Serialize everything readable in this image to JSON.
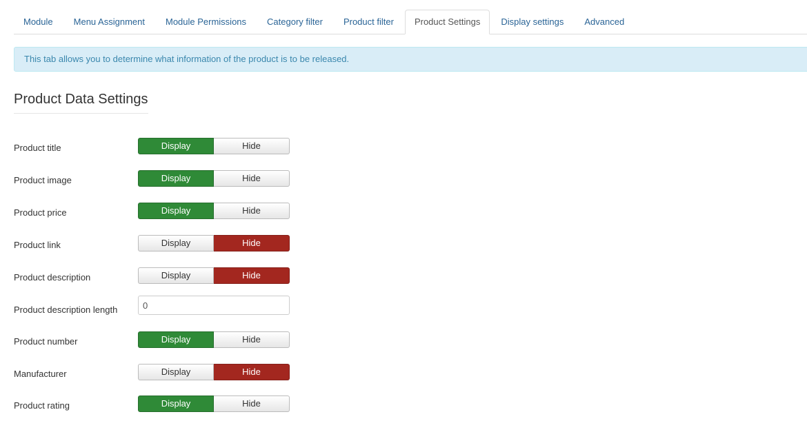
{
  "tabs": [
    {
      "label": "Module",
      "active": false
    },
    {
      "label": "Menu Assignment",
      "active": false
    },
    {
      "label": "Module Permissions",
      "active": false
    },
    {
      "label": "Category filter",
      "active": false
    },
    {
      "label": "Product filter",
      "active": false
    },
    {
      "label": "Product Settings",
      "active": true
    },
    {
      "label": "Display settings",
      "active": false
    },
    {
      "label": "Advanced",
      "active": false
    }
  ],
  "alert": {
    "text": "This tab allows you to determine what information of the product is to be released."
  },
  "section": {
    "title": "Product Data Settings"
  },
  "toggle_labels": {
    "display": "Display",
    "hide": "Hide"
  },
  "colors": {
    "display_active": "#2f8a37",
    "hide_active": "#a3271f",
    "link": "#2a6496",
    "alert_bg": "#d9edf7"
  },
  "settings": {
    "product_title": {
      "label": "Product title",
      "state": "display"
    },
    "product_image": {
      "label": "Product image",
      "state": "display"
    },
    "product_price": {
      "label": "Product price",
      "state": "display"
    },
    "product_link": {
      "label": "Product link",
      "state": "hide"
    },
    "product_description": {
      "label": "Product description",
      "state": "hide"
    },
    "product_description_length": {
      "label": "Product description length",
      "value": "0"
    },
    "product_number": {
      "label": "Product number",
      "state": "display"
    },
    "manufacturer": {
      "label": "Manufacturer",
      "state": "hide"
    },
    "product_rating": {
      "label": "Product rating",
      "state": "display"
    }
  }
}
